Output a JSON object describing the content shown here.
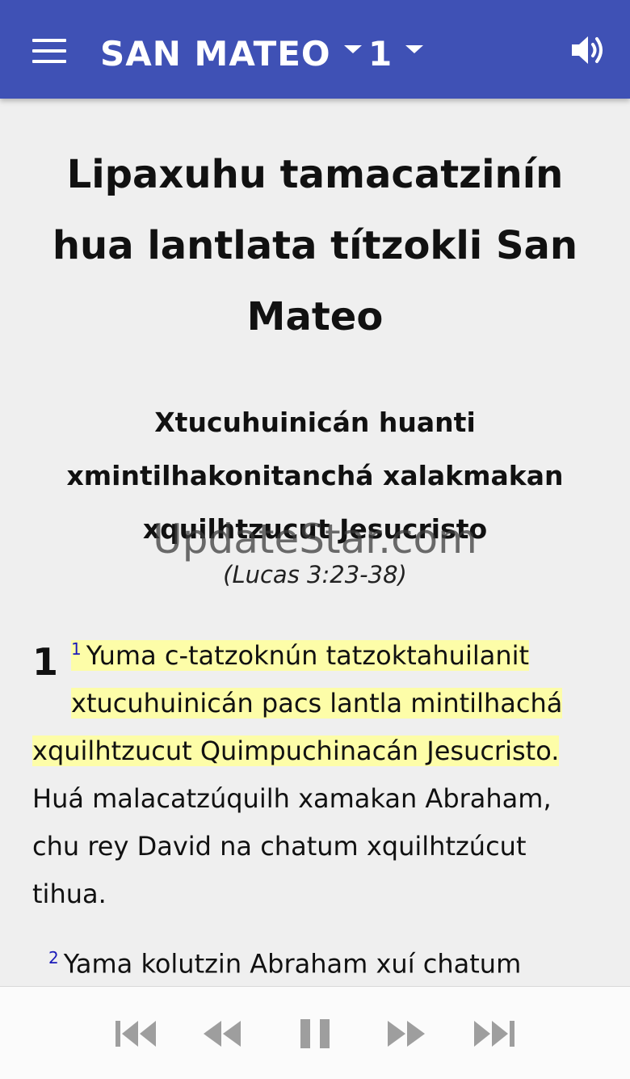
{
  "appbar": {
    "book": "SAN MATEO",
    "chapter": "1",
    "menu_icon": "menu-icon",
    "audio_icon": "speaker-icon",
    "color": "#3f51b5"
  },
  "content": {
    "title": "Lipaxuhu tamacatzinín hua lantlata títzokli San Mateo",
    "section_heading": "Xtucuhuinicán huanti xmintilhakonitanchá xalakmakan xquilhtzucut Jesucristo",
    "cross_reference": "(Lucas 3:23-38)",
    "chapter_number": "1",
    "verse1": {
      "number": "1",
      "line1": "Yuma c-tatzoknún tatzoktahuilanit",
      "line2": "xtucuhuinicán pacs lantla mintilhachá",
      "line3": "xquilhtzucut Quimpuchinacán Jesucristo.",
      "rest": "Huá malacatzúquilh xamakan Abraham, chu rey David na chatum xquilhtzúcut tihua."
    },
    "verse2": {
      "number": "2",
      "text": "Yama kolutzin Abraham xuí chatum"
    },
    "highlight_color": "#fdfda8"
  },
  "watermark": "UpdateStar.com",
  "player": {
    "skip_previous_icon": "skip-previous-icon",
    "rewind_icon": "rewind-icon",
    "pause_icon": "pause-icon",
    "fast_forward_icon": "fast-forward-icon",
    "skip_next_icon": "skip-next-icon"
  }
}
